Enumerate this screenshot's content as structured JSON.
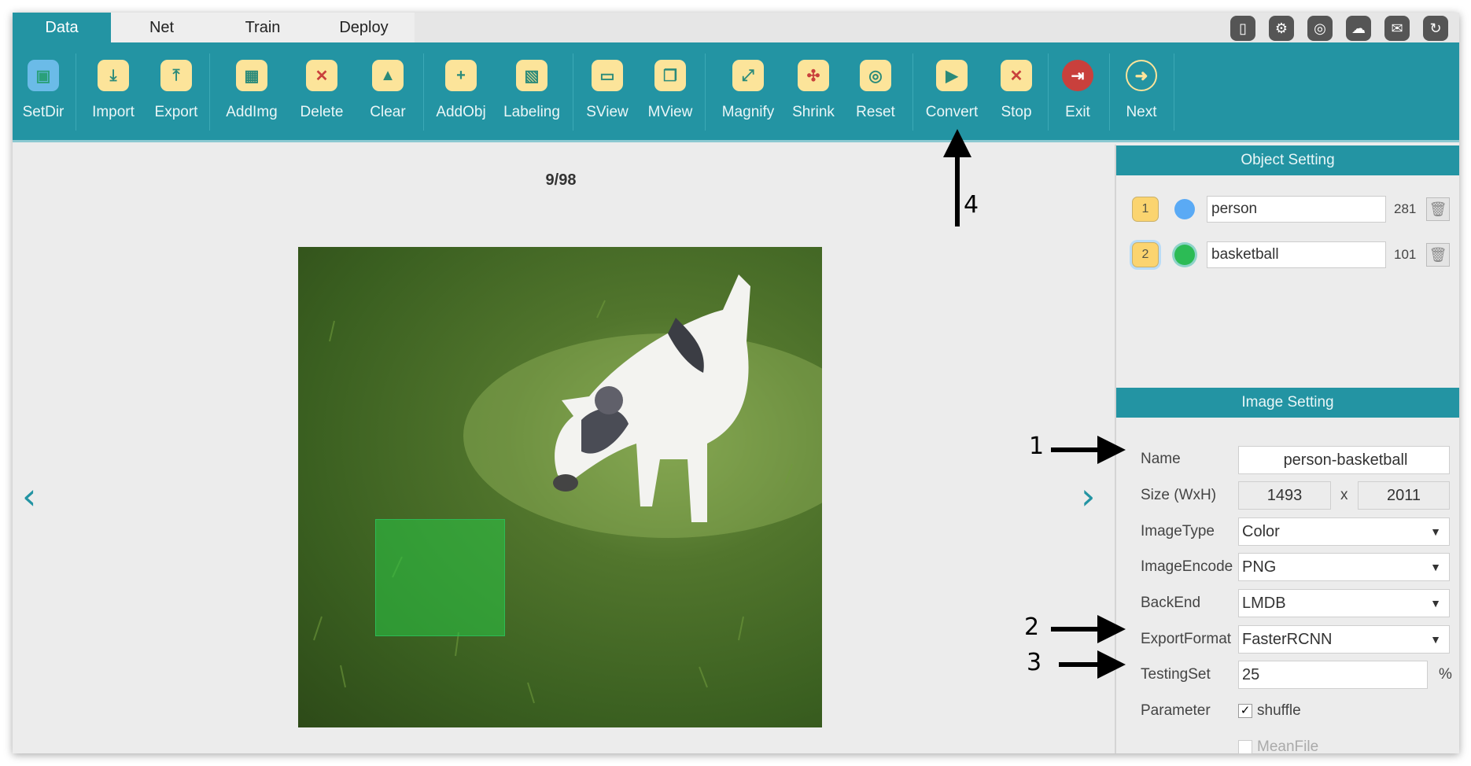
{
  "tabs": [
    {
      "label": "Data",
      "active": true
    },
    {
      "label": "Net"
    },
    {
      "label": "Train"
    },
    {
      "label": "Deploy"
    }
  ],
  "system_icons": [
    "phone-icon",
    "gear-icon",
    "compass-icon",
    "wechat-icon",
    "mail-icon",
    "refresh-icon"
  ],
  "toolbar": [
    {
      "label": "SetDir",
      "icon": "folder-icon"
    },
    {
      "label": "Import",
      "icon": "import-icon"
    },
    {
      "label": "Export",
      "icon": "export-icon"
    },
    {
      "label": "AddImg",
      "icon": "add-image-icon"
    },
    {
      "label": "Delete",
      "icon": "delete-image-icon"
    },
    {
      "label": "Clear",
      "icon": "clear-icon"
    },
    {
      "label": "AddObj",
      "icon": "add-object-icon"
    },
    {
      "label": "Labeling",
      "icon": "labeling-icon"
    },
    {
      "label": "SView",
      "icon": "single-view-icon"
    },
    {
      "label": "MView",
      "icon": "multi-view-icon"
    },
    {
      "label": "Magnify",
      "icon": "magnify-icon"
    },
    {
      "label": "Shrink",
      "icon": "shrink-icon"
    },
    {
      "label": "Reset",
      "icon": "reset-icon"
    },
    {
      "label": "Convert",
      "icon": "play-icon"
    },
    {
      "label": "Stop",
      "icon": "stop-icon"
    },
    {
      "label": "Exit",
      "icon": "exit-icon"
    },
    {
      "label": "Next",
      "icon": "next-arrow-icon"
    }
  ],
  "viewer": {
    "counter": "9/98"
  },
  "object_setting": {
    "title": "Object Setting",
    "objects": [
      {
        "index": "1",
        "name": "person",
        "count": "281",
        "color": "#5aaaf5"
      },
      {
        "index": "2",
        "name": "basketball",
        "count": "101",
        "color": "#2cbb55"
      }
    ]
  },
  "image_setting": {
    "title": "Image Setting",
    "name_label": "Name",
    "name": "person-basketball",
    "size_label": "Size (WxH)",
    "width": "1493",
    "x": "x",
    "height": "2011",
    "imagetype_label": "ImageType",
    "imagetype": "Color",
    "imageencode_label": "ImageEncode",
    "imageencode": "PNG",
    "backend_label": "BackEnd",
    "backend": "LMDB",
    "exportformat_label": "ExportFormat",
    "exportformat": "FasterRCNN",
    "testingset_label": "TestingSet",
    "testingset": "25",
    "percent": "%",
    "parameter_label": "Parameter",
    "shuffle_label": "shuffle",
    "shuffle": true,
    "meanfile_label": "MeanFile",
    "meanfile": false
  },
  "annotations": [
    "1",
    "2",
    "3",
    "4"
  ],
  "accent": "#2394a3"
}
